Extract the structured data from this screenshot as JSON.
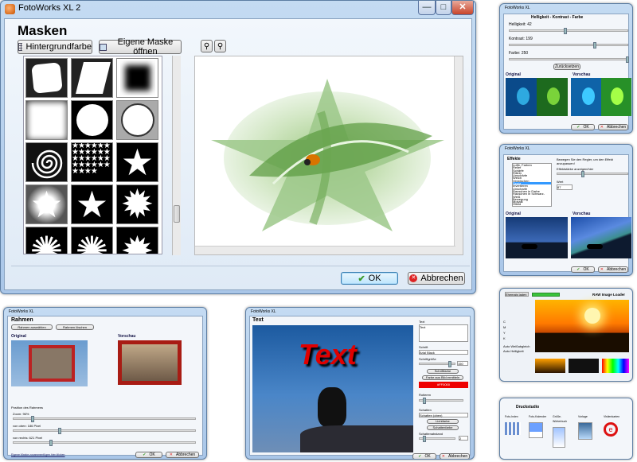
{
  "main_window": {
    "title": "FotoWorks XL 2",
    "heading": "Masken",
    "toolbar": {
      "background_button": "Hintergrundfarbe",
      "open_mask_button": "Eigene Maske öffnen"
    },
    "ok_button": "OK",
    "cancel_button": "Abbrechen",
    "masks": [
      "rounded-square",
      "parallelogram",
      "soft-square",
      "soft-glow",
      "circle",
      "circle-outline",
      "spiral",
      "stars-pattern",
      "star",
      "star-glow",
      "star-outline",
      "burst",
      "flower",
      "flower-2",
      "flower-3"
    ]
  },
  "brightness_window": {
    "title": "FotoWorks XL",
    "heading": "Helligkeit - Kontrast - Farbe",
    "brightness_label": "Helligkeit: 42",
    "brightness_value": 0.45,
    "contrast_label": "Kontrast: 199",
    "contrast_value": 0.7,
    "color_label": "Farbe: 250",
    "color_value": 0.98,
    "reset_button": "Zurücksetzen",
    "original_label": "Original",
    "preview_label": "Vorschau",
    "ok_button": "OK",
    "cancel_button": "Abbrechen"
  },
  "effects_window": {
    "title": "FotoWorks XL",
    "heading": "Effekte",
    "hint": "Bewegen Sie den Regler, um den Effekt anzupassen!",
    "strength_label": "Effektstärke anzeigen/hier",
    "strength_value": 0.35,
    "value_label": "Wert",
    "value": "87",
    "effects_list": [
      "Luftb. Farben",
      "Relief",
      "Schärfe",
      "Rilleln",
      "Unschärfe",
      "Weich",
      "Verwischen",
      "Sepia",
      "Invertieren",
      "Unscharfe",
      "Rauschen in Farbe",
      "Rauschen in Schwarz-Weiß",
      "Bewegung",
      "Mosaik",
      "Ölbild",
      "Pechkugel"
    ],
    "selected_index": 7,
    "original_label": "Original",
    "preview_label": "Vorschau",
    "ok_button": "OK",
    "cancel_button": "Abbrechen"
  },
  "raw_window": {
    "title": "RAW Image Loader",
    "header_button": "Ehemals laden",
    "fields": [
      "C",
      "M",
      "Y",
      "K"
    ],
    "checkbox_1": "Auto Weißabgleich",
    "checkbox_2": "Auto Helligkeit"
  },
  "print_window": {
    "title": "FotoWorks XL",
    "heading": "Druckstudio",
    "options": [
      "Foto-Index",
      "Foto-Kalender",
      "Größe-Wörterbuch",
      "Vorlage",
      "Visitenkarten"
    ]
  },
  "frames_window": {
    "title": "FotoWorks XL",
    "heading": "Rahmen",
    "choose_button": "Rahmen auswählen",
    "delete_button": "Rahmen löschen",
    "original_label": "Original",
    "preview_label": "Vorschau",
    "position_label": "Position des Rahmens",
    "zoom_label": "Zoom: 96%",
    "zoom_value": 0.1,
    "top_label": "von oben: 186 Pixel",
    "top_value": 0.25,
    "left_label": "von rechts: 621 Pixel",
    "left_value": 0.2,
    "footer_link": "Eigene Maske zusammenfügen hier klicken",
    "ok_button": "OK",
    "cancel_button": "Abbrechen"
  },
  "text_window": {
    "title": "FotoWorks XL",
    "heading": "Text",
    "preview_text": "Text",
    "text_label": "Text",
    "text_value": "Text",
    "font_label": "Schrift",
    "font_value": "Arial Black",
    "size_label": "Schriftgröße",
    "size_value": "150",
    "font_button": "Schriftfarbe",
    "color_button": "Farbe aus Bild ermitteln",
    "color_value": "#FF0000",
    "rotation_label": "Rotieren",
    "shadow_label": "Schatten",
    "shadow_value": "Schatten (oben)",
    "light_button": "Lichtfarbe",
    "shadow_button": "Schattenfarbe",
    "distance_label": "Schattenabstand",
    "distance_value": "2",
    "ok_button": "OK",
    "cancel_button": "Abbrechen"
  },
  "colors": {
    "accent": "#3399ff",
    "title_red": "#e00000",
    "frame_red": "#a81c14"
  }
}
